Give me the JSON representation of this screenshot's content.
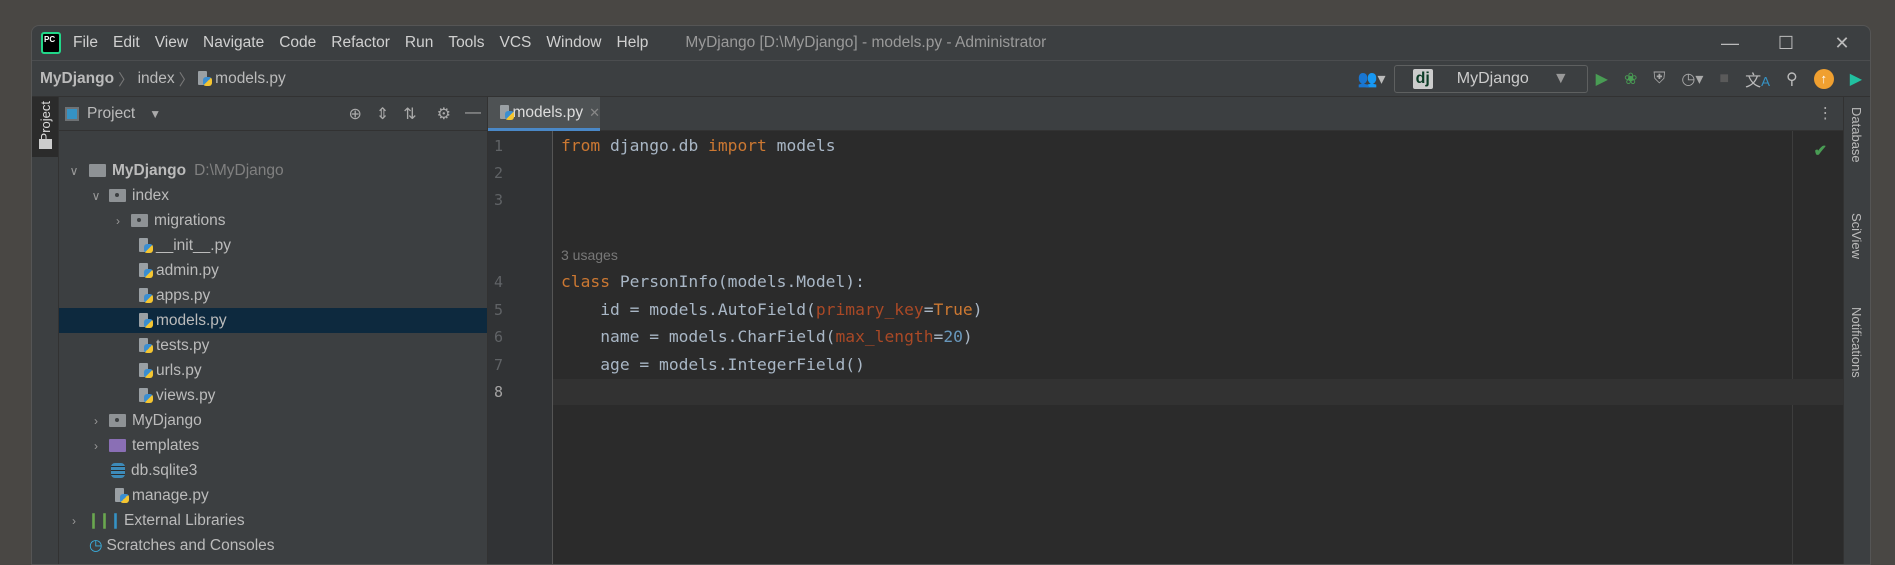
{
  "title_bar": {
    "menu": [
      "File",
      "Edit",
      "View",
      "Navigate",
      "Code",
      "Refactor",
      "Run",
      "Tools",
      "VCS",
      "Window",
      "Help"
    ],
    "window_title": "MyDjango [D:\\MyDjango] - models.py - Administrator"
  },
  "breadcrumb": [
    "MyDjango",
    "index",
    "models.py"
  ],
  "toolbar": {
    "run_config": "MyDjango",
    "accent_run": "#499c54",
    "update_color": "#f0a030"
  },
  "left_stripe": {
    "project_label": "Project"
  },
  "project_panel": {
    "title": "Project",
    "tree": [
      {
        "label": "MyDjango",
        "hint": "D:\\MyDjango",
        "type": "root"
      },
      {
        "label": "index",
        "type": "module"
      },
      {
        "label": "migrations",
        "type": "module"
      },
      {
        "label": "__init__.py",
        "type": "py"
      },
      {
        "label": "admin.py",
        "type": "py"
      },
      {
        "label": "apps.py",
        "type": "py"
      },
      {
        "label": "models.py",
        "type": "py",
        "selected": true
      },
      {
        "label": "tests.py",
        "type": "py"
      },
      {
        "label": "urls.py",
        "type": "py"
      },
      {
        "label": "views.py",
        "type": "py"
      },
      {
        "label": "MyDjango",
        "type": "module"
      },
      {
        "label": "templates",
        "type": "templates"
      },
      {
        "label": "db.sqlite3",
        "type": "db"
      },
      {
        "label": "manage.py",
        "type": "py"
      },
      {
        "label": "External Libraries",
        "type": "libs"
      },
      {
        "label": "Scratches and Consoles",
        "type": "scratch"
      }
    ]
  },
  "editor": {
    "tab": "models.py",
    "usages_hint": "3 usages",
    "lines": [
      "1",
      "2",
      "3",
      "4",
      "5",
      "6",
      "7",
      "8"
    ],
    "code": {
      "l1": [
        "from",
        " django.db ",
        "import",
        " models"
      ],
      "l4": [
        "class",
        " PersonInfo(models.Model):"
      ],
      "l5": [
        "    id = models.AutoField(",
        "primary_key",
        "=",
        "True",
        ")"
      ],
      "l6": [
        "    name = models.CharField(",
        "max_length",
        "=",
        "20",
        ")"
      ],
      "l7": [
        "    age = models.IntegerField()"
      ]
    }
  },
  "right_stripe": [
    "Database",
    "SciView",
    "Notifications"
  ]
}
